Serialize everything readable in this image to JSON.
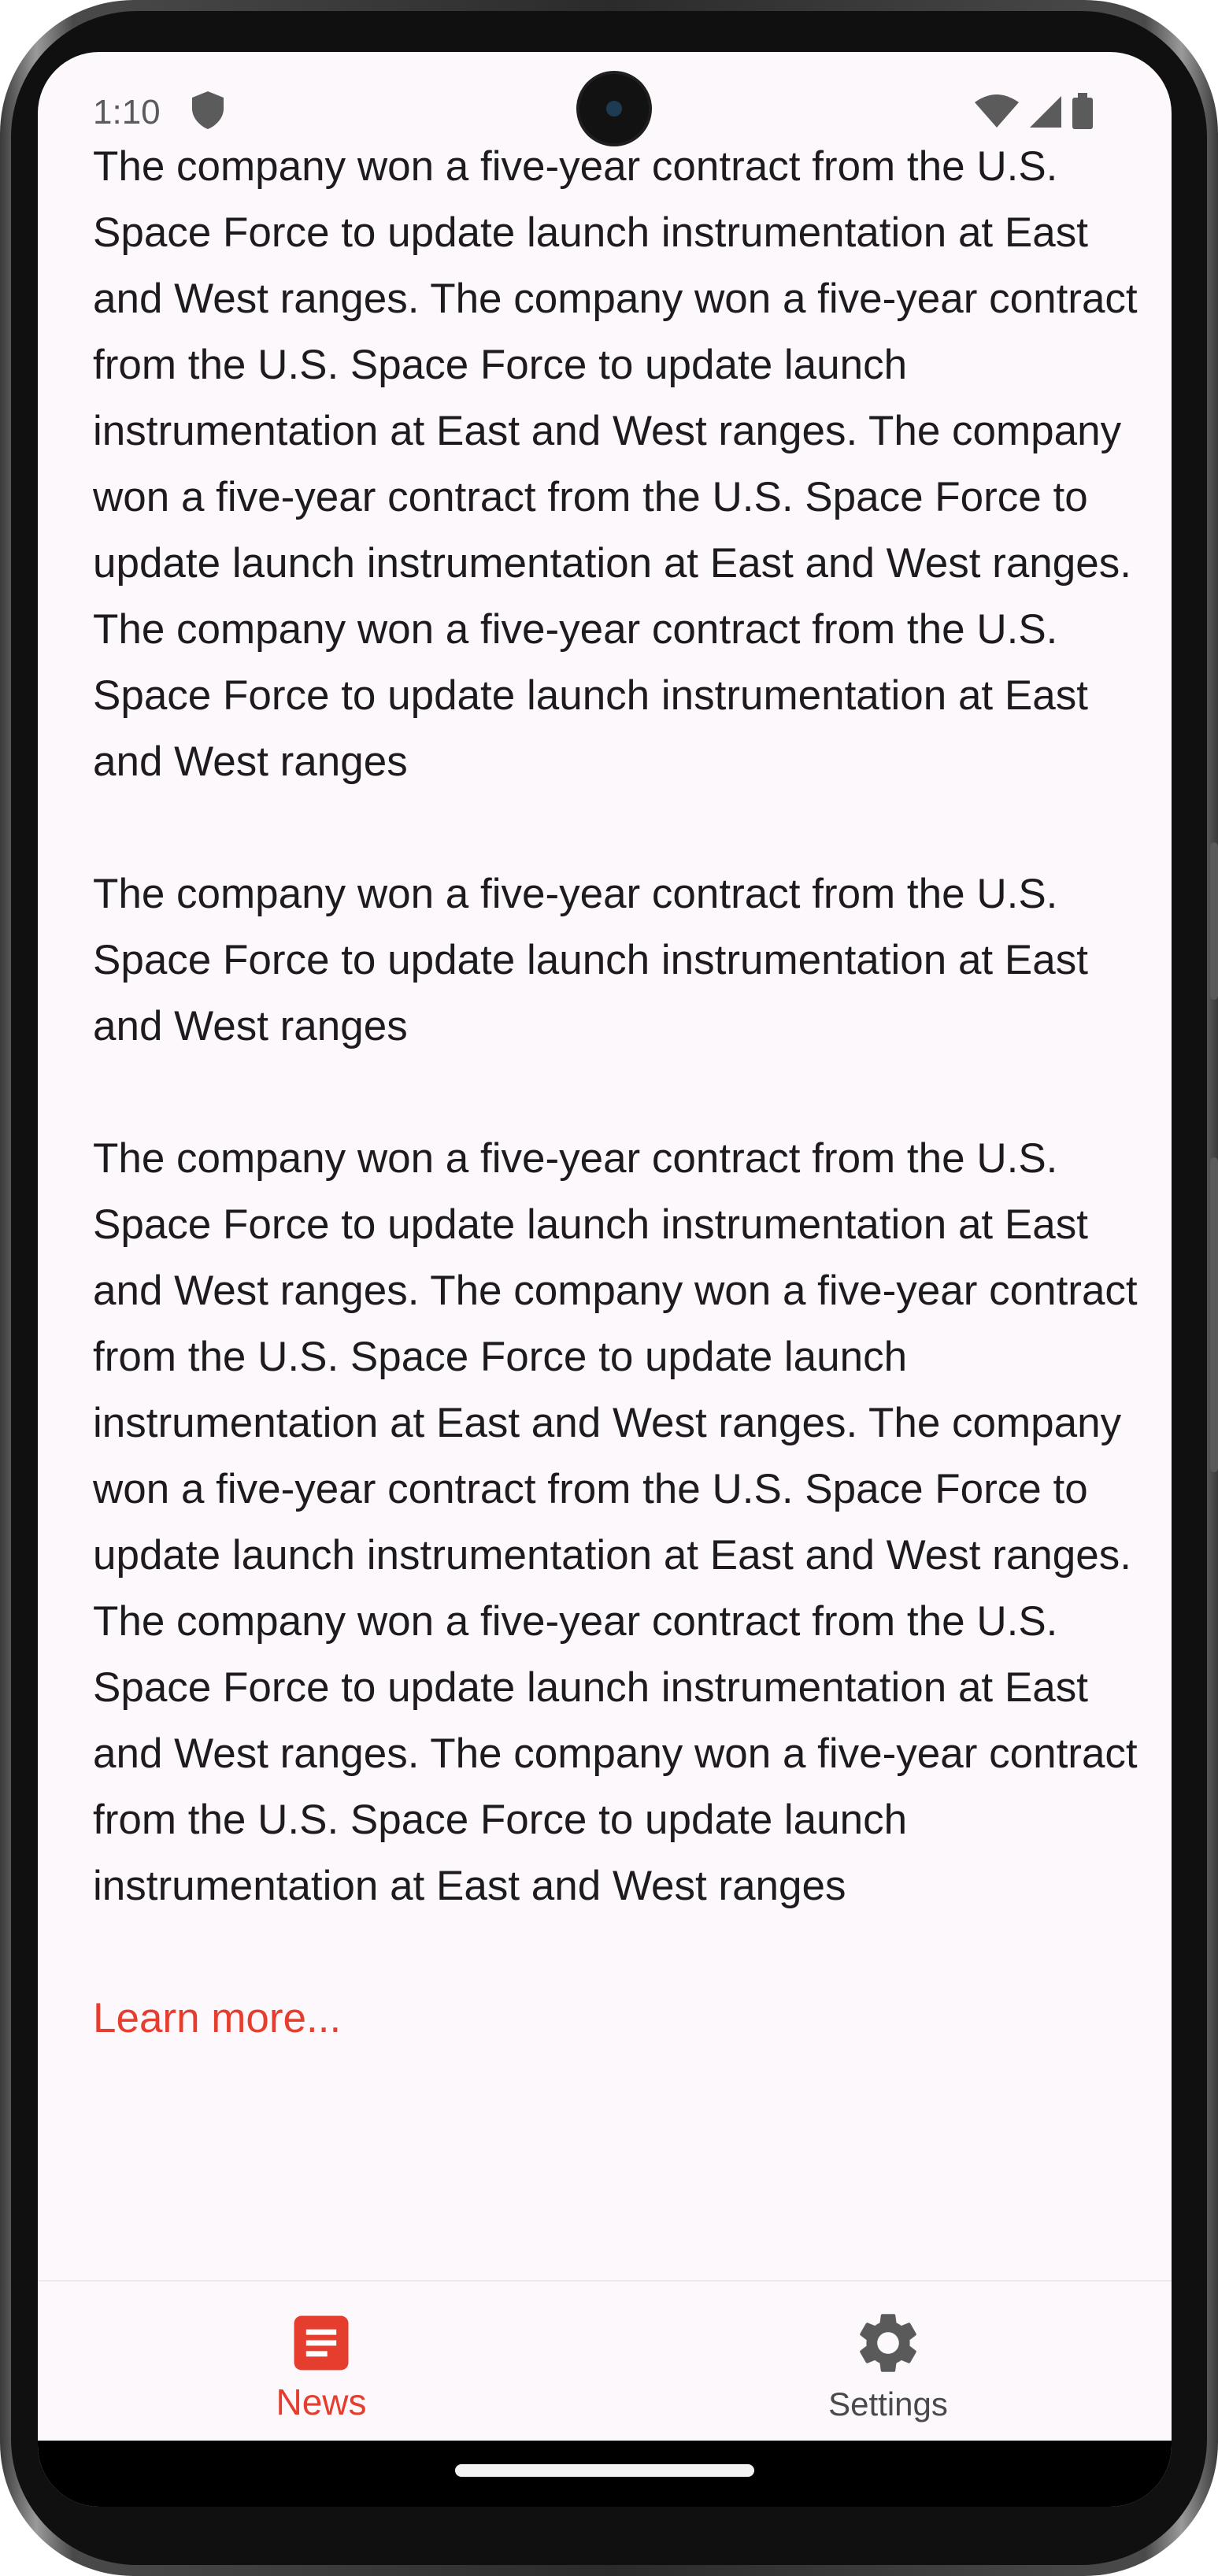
{
  "status_bar": {
    "time": "1:10",
    "icons": [
      "shield-icon",
      "wifi-icon",
      "signal-icon",
      "battery-icon"
    ]
  },
  "article": {
    "paragraphs": [
      "The company won a five-year contract from the U.S. Space Force to update launch instrumentation at East and West ranges. The company won a five-year contract from the U.S. Space Force to update launch instrumentation at East and West ranges. The company won a five-year contract from the U.S. Space Force to update launch instrumentation at East and West ranges. The company won a five-year contract from the U.S. Space Force to update launch instrumentation at East and West ranges",
      "The company won a five-year contract from the U.S. Space Force to update launch instrumentation at East and West ranges",
      "The company won a five-year contract from the U.S. Space Force to update launch instrumentation at East and West ranges. The company won a five-year contract from the U.S. Space Force to update launch instrumentation at East and West ranges. The company won a five-year contract from the U.S. Space Force to update launch instrumentation at East and West ranges. The company won a five-year contract from the U.S. Space Force to update launch instrumentation at East and West ranges. The company won a five-year contract from the U.S. Space Force to update launch instrumentation at East and West ranges"
    ],
    "learn_more": "Learn more..."
  },
  "bottom_nav": {
    "items": [
      {
        "label": "News",
        "icon": "news-icon",
        "active": true
      },
      {
        "label": "Settings",
        "icon": "gear-icon",
        "active": false
      }
    ]
  },
  "colors": {
    "accent": "#e53e2e",
    "background": "#fdf8fc",
    "text": "#1d1b1e",
    "inactive": "#4a4a4a"
  }
}
